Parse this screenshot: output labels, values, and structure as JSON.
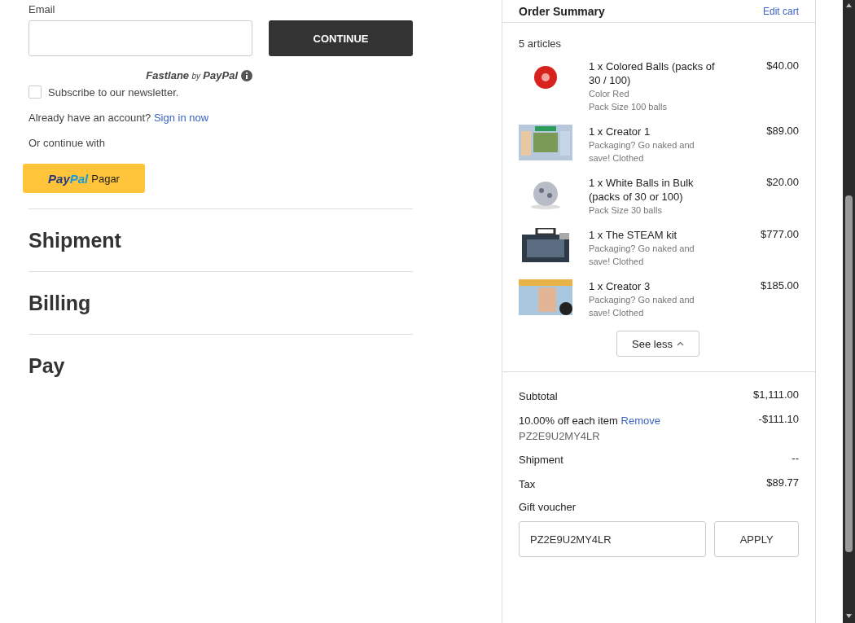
{
  "contact": {
    "email_label": "Email",
    "continue_button": "CONTINUE",
    "fastlane": {
      "brand": "Fastlane",
      "by": "by",
      "partner": "PayPal"
    },
    "newsletter": {
      "label": "Subscribe to our newsletter.",
      "checked": false
    },
    "account_prompt": "Already have an account?",
    "sign_in_link": "Sign in now",
    "alt_label": "Or continue with",
    "paypal_button": {
      "brand_a": "Pay",
      "brand_b": "Pal",
      "action": "Pagar"
    }
  },
  "sections": [
    {
      "title": "Shipment"
    },
    {
      "title": "Billing"
    },
    {
      "title": "Pay"
    }
  ],
  "summary": {
    "title": "Order Summary",
    "edit_link": "Edit cart",
    "count": "5 articles",
    "items": [
      {
        "title": "1 x Colored Balls (packs of 30 / 100)",
        "details": [
          "Color Red",
          "Pack Size 100 balls"
        ],
        "price": "$40.00"
      },
      {
        "title": "1 x Creator 1",
        "details": [
          "Packaging? Go naked and save! Clothed"
        ],
        "price": "$89.00"
      },
      {
        "title": "1 x White Balls in Bulk (packs of 30 or 100)",
        "details": [
          "Pack Size 30 balls"
        ],
        "price": "$20.00"
      },
      {
        "title": "1 x The STEAM kit",
        "details": [
          "Packaging? Go naked and save! Clothed"
        ],
        "price": "$777.00"
      },
      {
        "title": "1 x Creator 3",
        "details": [
          "Packaging? Go naked and save! Clothed"
        ],
        "price": "$185.00"
      }
    ],
    "see_less": "See less",
    "totals": [
      {
        "label": "Subtotal",
        "value": "$1,111.00"
      },
      {
        "label": "10.00% off each item",
        "link": "Remove",
        "code": "PZ2E9U2MY4LR",
        "value": "-$111.10"
      },
      {
        "label": "Shipment",
        "value": "--"
      },
      {
        "label": "Tax",
        "value": "$89.77"
      }
    ],
    "voucher_label": "Gift voucher",
    "voucher_value": "PZ2E9U2MY4LR",
    "apply_button": "APPLY"
  }
}
